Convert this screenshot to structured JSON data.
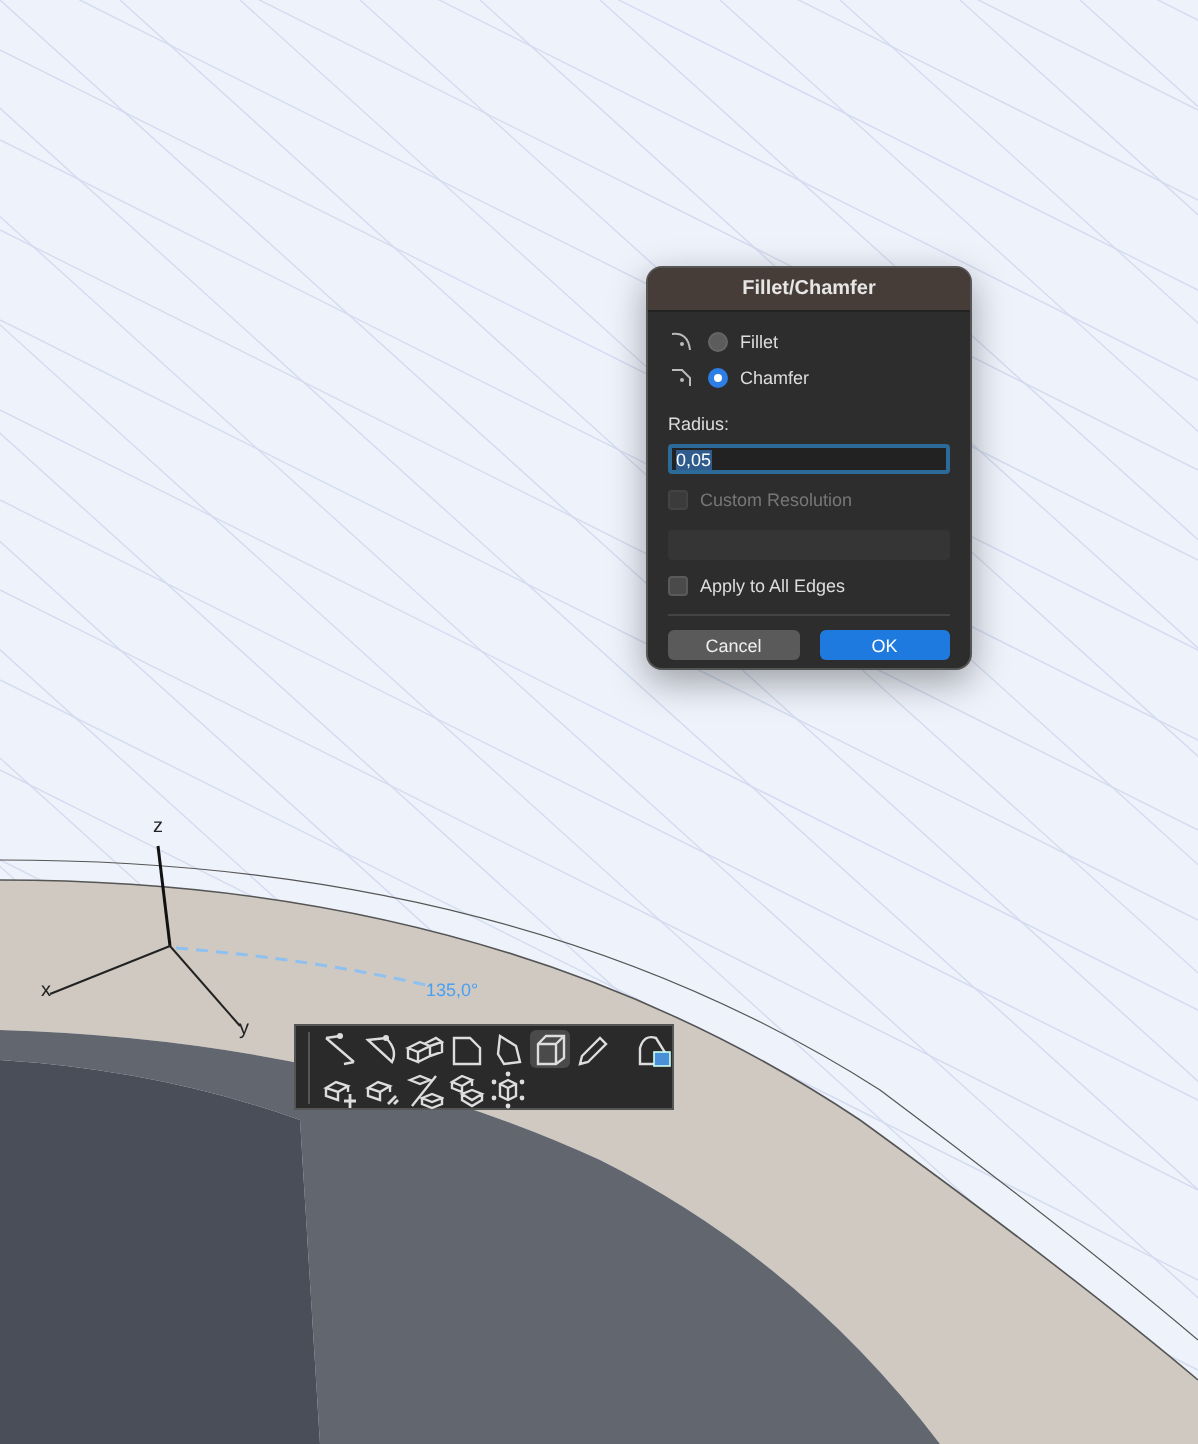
{
  "viewport": {
    "axes": [
      "x",
      "y",
      "z"
    ],
    "angle_label": "135,0°"
  },
  "dialog": {
    "title": "Fillet/Chamfer",
    "options": [
      {
        "label": "Fillet",
        "selected": false
      },
      {
        "label": "Chamfer",
        "selected": true
      }
    ],
    "radius_label": "Radius:",
    "radius_value": "0,05",
    "custom_resolution": {
      "label": "Custom Resolution",
      "checked": false,
      "disabled": true
    },
    "apply_all": {
      "label": "Apply to All Edges",
      "checked": false
    },
    "buttons": [
      {
        "label": "Cancel",
        "kind": "secondary"
      },
      {
        "label": "OK",
        "kind": "primary"
      }
    ]
  },
  "toolbar": {
    "rows": [
      [
        {
          "selected": false
        },
        {
          "selected": false
        },
        {
          "selected": false
        },
        {
          "selected": false
        },
        {
          "selected": false
        },
        {
          "selected": true
        },
        {
          "selected": false
        },
        {
          "selected": false
        }
      ],
      [
        {
          "selected": false
        },
        {
          "selected": false
        },
        {
          "selected": false
        },
        {
          "selected": false
        },
        {
          "selected": false
        }
      ]
    ]
  }
}
